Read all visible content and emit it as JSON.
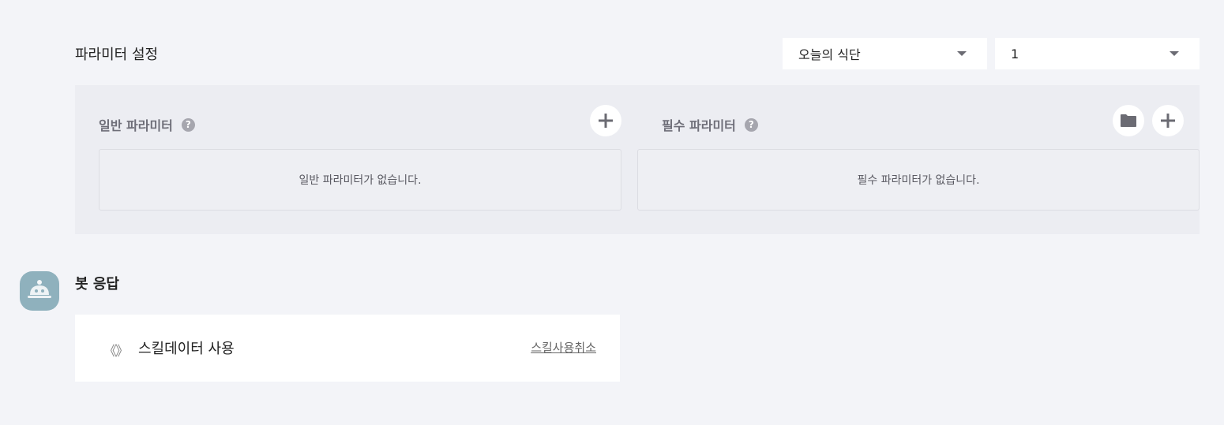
{
  "params": {
    "title": "파라미터 설정",
    "select_block": "오늘의 식단",
    "select_number": "1",
    "general": {
      "label": "일반 파라미터",
      "empty_text": "일반 파라미터가 없습니다."
    },
    "required": {
      "label": "필수 파라미터",
      "empty_text": "필수 파라미터가 없습니다."
    },
    "help_glyph": "?"
  },
  "bot": {
    "title": "봇 응답",
    "skill_icon": "《》",
    "skill_label": "스킬데이터 사용",
    "skill_cancel": "스킬사용취소"
  },
  "icons": {
    "plus": "plus-icon",
    "folder": "folder-icon",
    "help": "help-icon",
    "bot": "bot-icon",
    "dropdown": "chevron-down-icon"
  },
  "colors": {
    "page_bg": "#f3f4f8",
    "panel_bg": "#ecedf2",
    "avatar_bg": "#8fb1bd",
    "icon_gray": "#6b6b73"
  }
}
